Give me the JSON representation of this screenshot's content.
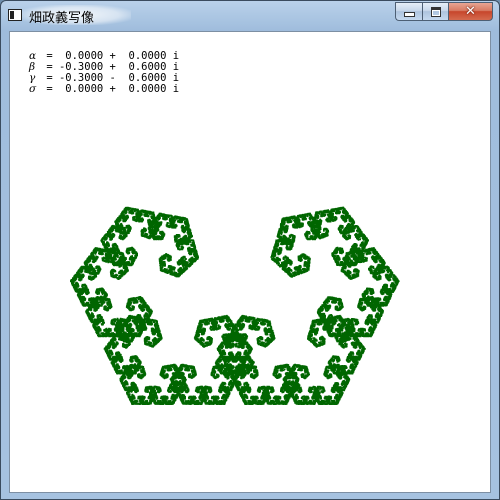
{
  "window": {
    "title": "畑政義写像",
    "close_glyph": "✕"
  },
  "parameters": [
    {
      "symbol": "α",
      "text": " =  0.0000 +  0.0000 i"
    },
    {
      "symbol": "β",
      "text": " = -0.3000 +  0.6000 i"
    },
    {
      "symbol": "γ",
      "text": " = -0.3000 -  0.6000 i"
    },
    {
      "symbol": "σ",
      "text": " =  0.0000 +  0.0000 i"
    }
  ],
  "fractal": {
    "color": "#006600",
    "iterations": 11
  },
  "colors": {
    "accent_close": "#c7462b",
    "client_bg": "#ffffff"
  }
}
